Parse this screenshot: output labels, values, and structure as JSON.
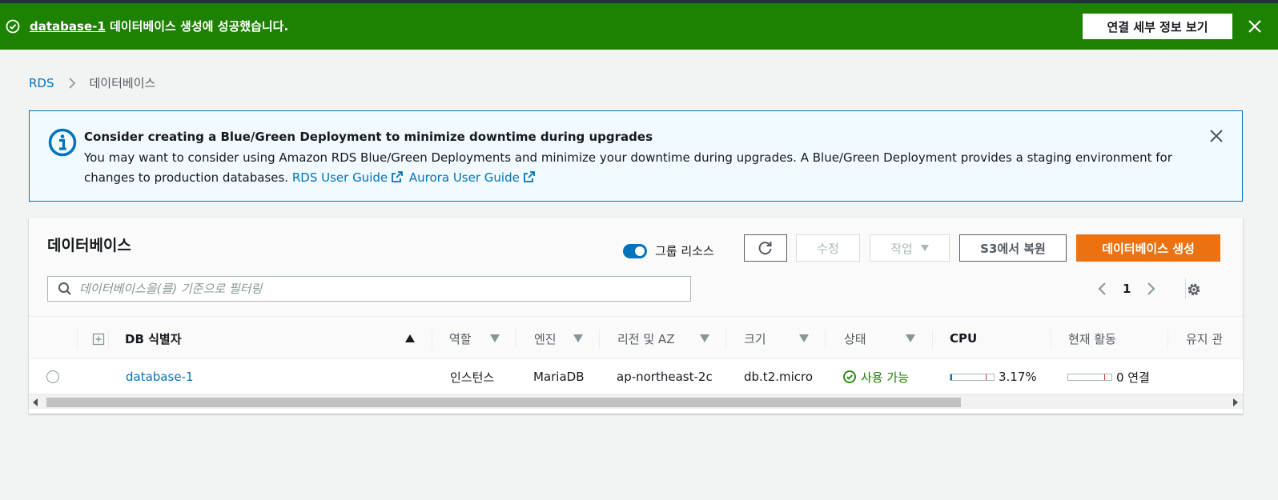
{
  "flash": {
    "db_link": "database-1",
    "message": " 데이터베이스 생성에 성공했습니다.",
    "button_label": "연결 세부 정보 보기",
    "type": "success",
    "color": "#1d8102",
    "icons": {
      "status": "check-circle-icon",
      "close": "close-icon"
    }
  },
  "breadcrumb": {
    "root": "RDS",
    "current": "데이터베이스",
    "separator_icon": "chevron-right-icon"
  },
  "alert": {
    "title": "Consider creating a Blue/Green Deployment to minimize downtime during upgrades",
    "body": "You may want to consider using Amazon RDS Blue/Green Deployments and minimize your downtime during upgrades. A Blue/Green Deployment provides a staging environment for changes to production databases.",
    "link1": "RDS User Guide",
    "link2": "Aurora User Guide",
    "color": "#0073bb",
    "icons": {
      "info": "info-icon",
      "external": "external-link-icon",
      "close": "close-icon"
    }
  },
  "panel": {
    "title": "데이터베이스",
    "group_toggle_label": "그룹 리소스",
    "group_toggle_on": true,
    "edit_label": "수정",
    "actions_label": "작업",
    "restore_label": "S3에서 복원",
    "create_label": "데이터베이스 생성",
    "create_color": "#ec7211",
    "search_placeholder": "데이터베이스을(를) 기준으로 필터링",
    "search_value": "",
    "page": "1",
    "icons": {
      "refresh": "refresh-icon",
      "search": "search-icon",
      "prev": "chevron-left-icon",
      "next": "chevron-right-icon",
      "settings": "gear-icon"
    }
  },
  "table": {
    "columns": {
      "id": "DB 식별자",
      "role": "역할",
      "engine": "엔진",
      "region": "리전 및 AZ",
      "size": "크기",
      "status": "상태",
      "cpu": "CPU",
      "activity": "현재 활동",
      "maintenance": "유지 관"
    },
    "sort": {
      "column": "id",
      "direction": "ascending"
    },
    "rows": [
      {
        "id": "database-1",
        "role": "인스턴스",
        "engine": "MariaDB",
        "region": "ap-northeast-2c",
        "size": "db.t2.micro",
        "status": "사용 가능",
        "status_color": "#1d8102",
        "cpu": "3.17%",
        "cpu_fraction": 0.0317,
        "activity": "0 연결",
        "activity_fraction": 0
      }
    ]
  }
}
